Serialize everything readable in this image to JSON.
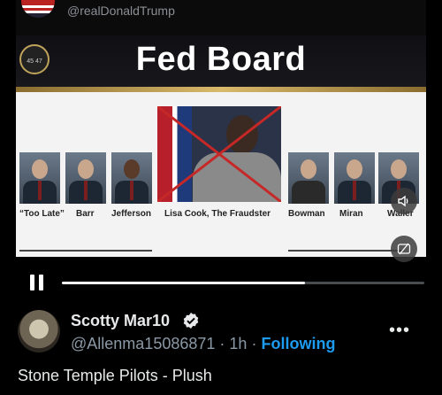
{
  "video": {
    "embedded_handle": "@realDonaldTrump",
    "slide_title": "Fed Board",
    "seal_text": "45 47",
    "labels": [
      "“Too Late”",
      "Barr",
      "Jefferson",
      "Lisa Cook, The Fraudster",
      "Bowman",
      "Miran",
      "Waller"
    ],
    "progress": 0.67
  },
  "post": {
    "display_name": "Scotty Mar10",
    "handle": "@Allenma15086871",
    "separator": "·",
    "time": "1h",
    "follow_label": "Following",
    "more_label": "•••",
    "text": "Stone Temple Pilots - Plush"
  },
  "icons": {
    "volume": "volume-icon",
    "captions": "captions-icon",
    "pause": "pause-icon",
    "verified": "verified-badge-icon"
  },
  "colors": {
    "accent": "#1d9bf0",
    "gold": "#d9b96a",
    "cross": "#c62828"
  }
}
